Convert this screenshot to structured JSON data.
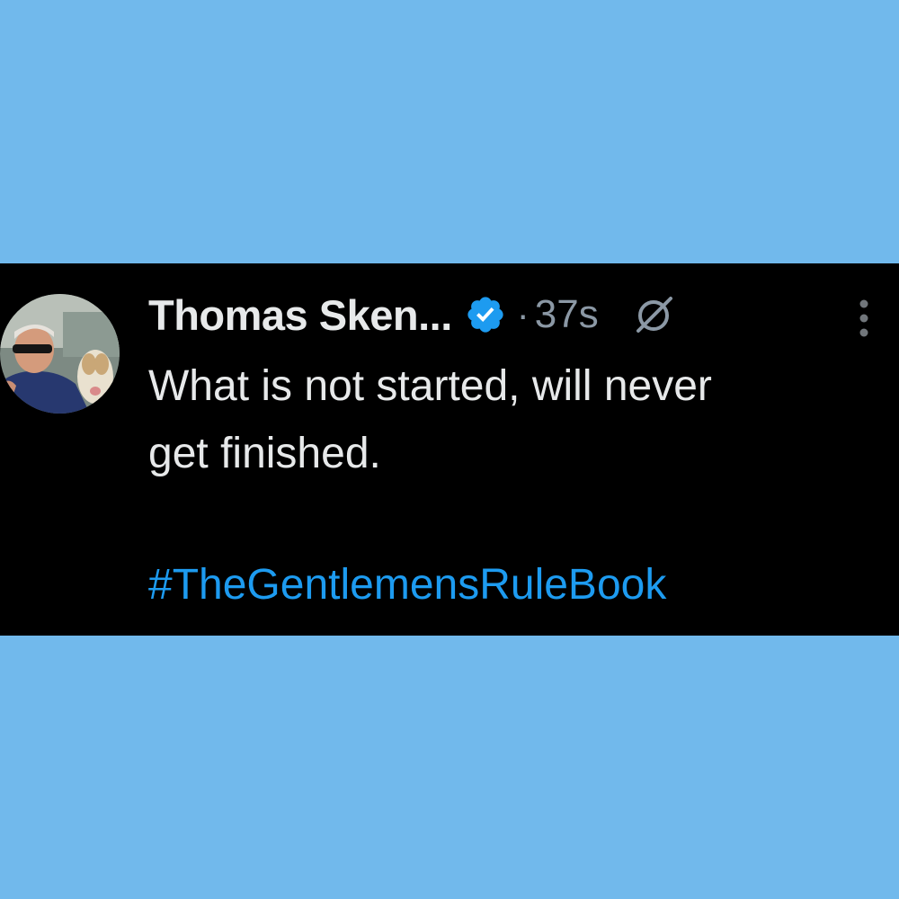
{
  "background_color": "#71b9ec",
  "panel_color": "#000000",
  "accent_color": "#1d9bf0",
  "tweet": {
    "author_name": "Thomas Sken...",
    "verified": true,
    "separator": "·",
    "timestamp": "37s",
    "text_line_1": "What is not started, will never",
    "text_line_2": "get finished.",
    "hashtag": "#TheGentlemensRuleBook"
  },
  "icons": {
    "verified": "verified-badge-icon",
    "grok": "grok-icon",
    "more": "more-vertical-icon",
    "avatar": "profile-photo"
  }
}
